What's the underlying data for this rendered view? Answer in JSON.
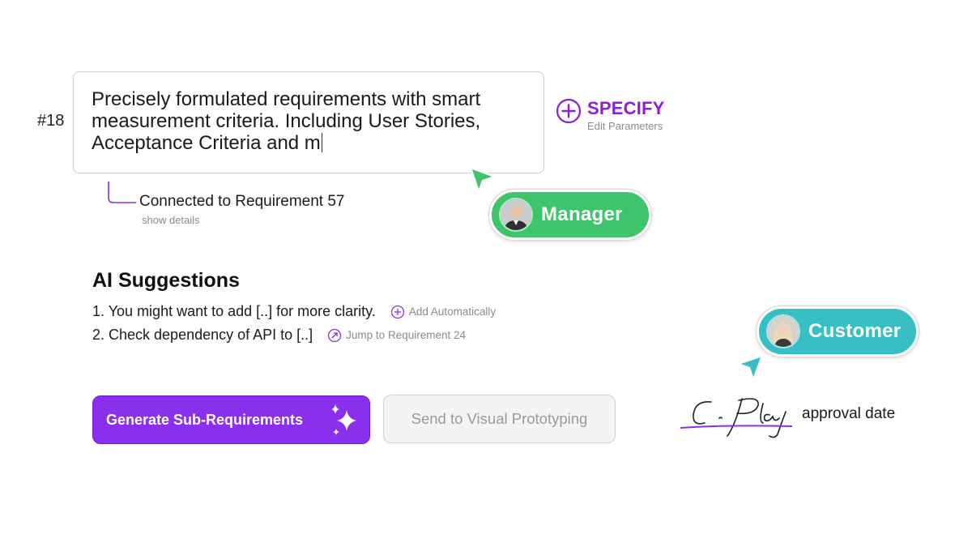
{
  "requirement": {
    "number": "#18",
    "text": "Precisely formulated requirements with smart measurement criteria. Including User Stories, Acceptance Criteria and m"
  },
  "specify": {
    "label": "SPECIFY",
    "sublabel": "Edit Parameters",
    "icon": "plus-circle-icon",
    "color": "#8a1fd6"
  },
  "connection": {
    "label": "Connected to Requirement 57",
    "details_link": "show details"
  },
  "ai_suggestions": {
    "title": "AI Suggestions",
    "items": [
      {
        "text": "1. You might want to add [..] for more clarity.",
        "action": "Add Automatically",
        "icon": "plus-circle-icon"
      },
      {
        "text": "2. Check dependency of API to [..]",
        "action": "Jump to Requirement 24",
        "icon": "arrow-up-right-circle-icon"
      }
    ]
  },
  "buttons": {
    "generate": {
      "label": "Generate Sub-Requirements",
      "icon": "sparkles-icon",
      "color": "#8a2fed"
    },
    "send": {
      "label": "Send to Visual Prototyping",
      "enabled": false
    }
  },
  "collaborators": {
    "manager": {
      "label": "Manager",
      "color": "#3ec46a"
    },
    "customer": {
      "label": "Customer",
      "color": "#37bfc4"
    }
  },
  "approval": {
    "signature": "C. Play",
    "label": "approval date"
  }
}
